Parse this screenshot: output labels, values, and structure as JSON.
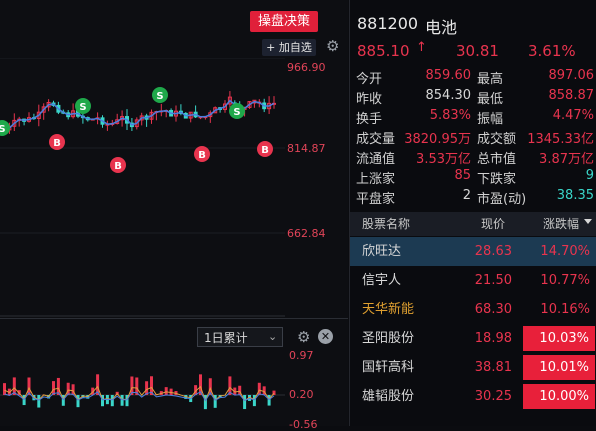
{
  "toolbar": {
    "strategy_button": "操盘决策",
    "add_favorite": "+ 加自选"
  },
  "chart": {
    "price_labels": [
      "966.90",
      "814.87",
      "662.84"
    ],
    "indicator_labels": [
      "0.97",
      "0.20",
      "-0.56"
    ],
    "period_select": "1日累计",
    "signals": [
      "S",
      "S",
      "S",
      "S",
      "B",
      "B",
      "B",
      "B"
    ]
  },
  "quote": {
    "code": "881200",
    "name": "电池",
    "last": "885.10",
    "change": "30.81",
    "pct": "3.61%",
    "stats": [
      {
        "label": "今开",
        "value": "859.60",
        "color": "red",
        "label2": "最高",
        "value2": "897.06",
        "color2": "red"
      },
      {
        "label": "昨收",
        "value": "854.30",
        "color": "white",
        "label2": "最低",
        "value2": "858.87",
        "color2": "red"
      },
      {
        "label": "换手",
        "value": "5.83%",
        "color": "red",
        "label2": "振幅",
        "value2": "4.47%",
        "color2": "red"
      },
      {
        "label": "成交量",
        "value": "3820.95万",
        "color": "red",
        "label2": "成交额",
        "value2": "1345.33亿",
        "color2": "red"
      },
      {
        "label": "流通值",
        "value": "3.53万亿",
        "color": "red",
        "label2": "总市值",
        "value2": "3.87万亿",
        "color2": "red"
      },
      {
        "label": "上涨家",
        "value": "85",
        "color": "red",
        "label2": "下跌家",
        "value2": "9",
        "color2": "cyan"
      },
      {
        "label": "平盘家",
        "value": "2",
        "color": "white",
        "label2": "市盈(动)",
        "value2": "38.35",
        "color2": "cyan"
      }
    ]
  },
  "stock_list": {
    "headers": [
      "股票名称",
      "现价",
      "涨跌幅"
    ],
    "rows": [
      {
        "name": "欣旺达",
        "price": "28.63",
        "pct": "14.70%"
      },
      {
        "name": "信宇人",
        "price": "21.50",
        "pct": "10.77%"
      },
      {
        "name": "天华新能",
        "price": "68.30",
        "pct": "10.16%"
      },
      {
        "name": "圣阳股份",
        "price": "18.98",
        "pct": "10.03%"
      },
      {
        "name": "国轩高科",
        "price": "38.81",
        "pct": "10.01%"
      },
      {
        "name": "雄韬股份",
        "price": "30.25",
        "pct": "10.00%"
      }
    ]
  },
  "colors": {
    "up": "#e8344e",
    "down": "#3ad6c9",
    "accent": "#e0203a"
  }
}
